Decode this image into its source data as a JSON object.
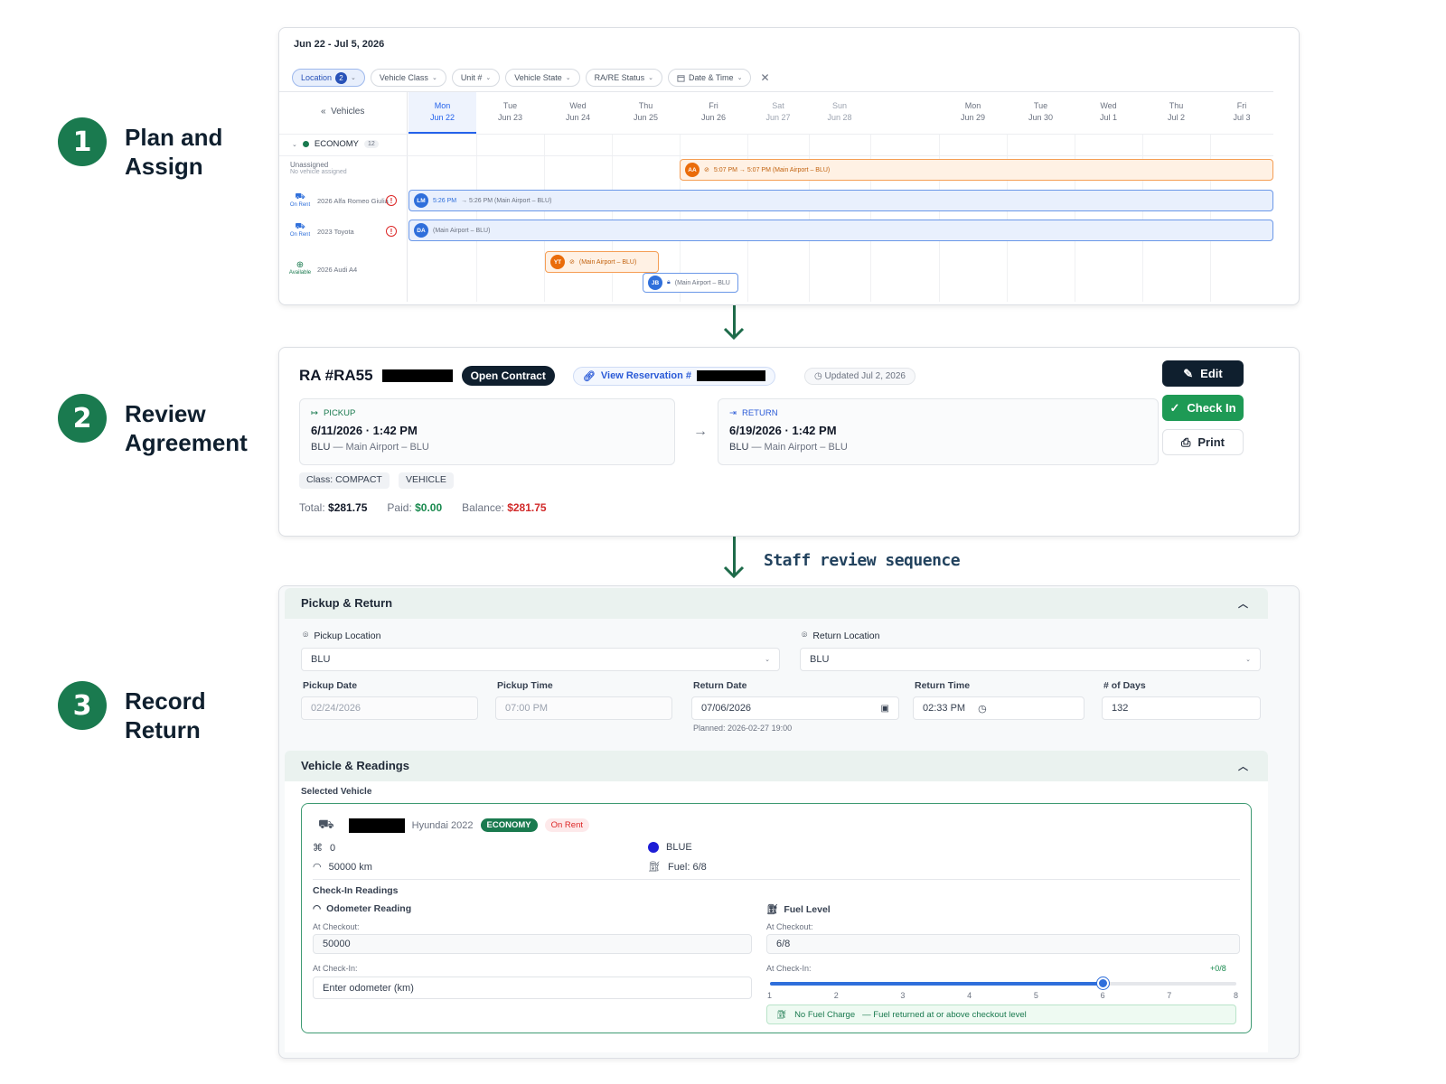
{
  "steps": [
    {
      "number": "1",
      "title": "Plan and\nAssign"
    },
    {
      "number": "2",
      "title": "Review\nAgreement"
    },
    {
      "number": "3",
      "title": "Record\nReturn"
    }
  ],
  "flow_label": "Staff review sequence",
  "scheduler": {
    "date_range": "Jun 22 - Jul 5, 2026",
    "filters": [
      {
        "label": "Location",
        "badge": "2",
        "active": true
      },
      {
        "label": "Vehicle Class"
      },
      {
        "label": "Unit #"
      },
      {
        "label": "Vehicle State"
      },
      {
        "label": "RA/RE Status"
      },
      {
        "label": "Date & Time"
      }
    ],
    "vehicles_header": "Vehicles",
    "days": [
      {
        "dow": "Mon",
        "date": "Jun 22",
        "today": true
      },
      {
        "dow": "Tue",
        "date": "Jun 23"
      },
      {
        "dow": "Wed",
        "date": "Jun 24"
      },
      {
        "dow": "Thu",
        "date": "Jun 25"
      },
      {
        "dow": "Fri",
        "date": "Jun 26"
      },
      {
        "dow": "Sat",
        "date": "Jun 27",
        "weekend": true
      },
      {
        "dow": "Sun",
        "date": "Jun 28",
        "weekend": true
      },
      {
        "dow": "Mon",
        "date": "Jun 29"
      },
      {
        "dow": "Tue",
        "date": "Jun 30"
      },
      {
        "dow": "Wed",
        "date": "Jul 1"
      },
      {
        "dow": "Thu",
        "date": "Jul 2"
      },
      {
        "dow": "Fri",
        "date": "Jul 3"
      }
    ],
    "group": {
      "name": "ECONOMY",
      "count": "12"
    },
    "rows": [
      {
        "name": "Unassigned",
        "sub": "No vehicle assigned"
      },
      {
        "status": "On Rent",
        "name": "2026 Alfa Romeo Giulia"
      },
      {
        "status": "On Rent",
        "name": "2023 Toyota"
      },
      {
        "status": "Available",
        "name": "2026 Audi A4"
      }
    ],
    "bookings": [
      {
        "initials": "AA",
        "text": "5:07 PM → 5:07 PM (Main Airport – BLU)"
      },
      {
        "initials": "LM",
        "text_time": "5:26 PM",
        "text": "→ 5:26 PM (Main Airport – BLU)"
      },
      {
        "initials": "DA",
        "text": "(Main Airport – BLU)"
      },
      {
        "initials": "YT",
        "text": "(Main Airport – BLU)"
      },
      {
        "initials": "JB",
        "text": "(Main Airport – BLU"
      }
    ]
  },
  "agreement": {
    "ra_number": "RA #RA55",
    "status": "Open Contract",
    "view_reservation": "View Reservation #",
    "updated": "Updated Jul 2, 2026",
    "pickup": {
      "label": "PICKUP",
      "datetime": "6/11/2026 · 1:42 PM",
      "code": "BLU",
      "location": "— Main Airport – BLU"
    },
    "return": {
      "label": "RETURN",
      "datetime": "6/19/2026 · 1:42 PM",
      "code": "BLU",
      "location": "— Main Airport – BLU"
    },
    "class_tag": "Class: COMPACT",
    "vehicle_tag": "VEHICLE",
    "total_label": "Total:",
    "total": "$281.75",
    "paid_label": "Paid:",
    "paid": "$0.00",
    "balance_label": "Balance:",
    "balance": "$281.75",
    "buttons": {
      "edit": "Edit",
      "check_in": "Check In",
      "print": "Print"
    }
  },
  "record_return": {
    "section1_title": "Pickup & Return",
    "pickup_location_label": "Pickup Location",
    "pickup_location": "BLU",
    "return_location_label": "Return Location",
    "return_location": "BLU",
    "pickup_date_label": "Pickup Date",
    "pickup_date": "02/24/2026",
    "pickup_time_label": "Pickup Time",
    "pickup_time": "07:00 PM",
    "return_date_label": "Return Date",
    "return_date": "07/06/2026",
    "return_time_label": "Return Time",
    "return_time": "02:33 PM",
    "days_label": "# of Days",
    "days": "132",
    "planned": "Planned: 2026-02-27 19:00",
    "section2_title": "Vehicle & Readings",
    "selected_vehicle_label": "Selected Vehicle",
    "vehicle_name": "Hyundai 2022",
    "vehicle_class": "ECONOMY",
    "vehicle_status": "On Rent",
    "tag_count": "0",
    "color": "BLUE",
    "color_hex": "#1d1dd6",
    "mileage": "50000 km",
    "fuel": "Fuel: 6/8",
    "checkin_readings": "Check-In Readings",
    "odometer_title": "Odometer Reading",
    "fuel_title": "Fuel Level",
    "at_checkout": "At Checkout:",
    "at_checkin": "At Check-In:",
    "odometer_checkout": "50000",
    "odometer_placeholder": "Enter odometer (km)",
    "fuel_checkout": "6/8",
    "fuel_delta": "+0/8",
    "fuel_level": 6,
    "fuel_max": 8,
    "fuel_ticks": [
      "1",
      "2",
      "3",
      "4",
      "5",
      "6",
      "7",
      "8"
    ],
    "no_fuel_charge": "No Fuel Charge",
    "no_fuel_note": "— Fuel returned at or above checkout level"
  }
}
